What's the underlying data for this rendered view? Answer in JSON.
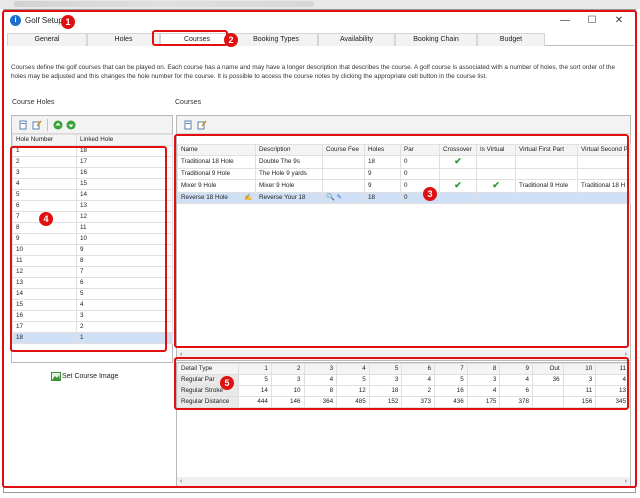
{
  "window": {
    "title": "Golf Setup",
    "app_icon": "golf-app-icon"
  },
  "window_controls": {
    "minimize": "—",
    "maximize": "☐",
    "close": "✕"
  },
  "tabs": [
    {
      "label": "General"
    },
    {
      "label": "Holes"
    },
    {
      "label": "Courses"
    },
    {
      "label": "Booking Types"
    },
    {
      "label": "Availability"
    },
    {
      "label": "Booking Chain"
    },
    {
      "label": "Budget"
    }
  ],
  "active_tab": "Courses",
  "description": "Courses define the golf courses that can be played on. Each course has a name and may have a longer description that describes the course. A golf course is associated with a number of holes, the sort order of the holes may be adjusted and this changes the hole number for the course. It is possible to access the course notes by clicking the appropriate cell button in the course list.",
  "course_holes": {
    "label": "Course Holes",
    "columns": [
      "Hole Number",
      "Linked Hole"
    ],
    "rows": [
      [
        "1",
        "18"
      ],
      [
        "2",
        "17"
      ],
      [
        "3",
        "16"
      ],
      [
        "4",
        "15"
      ],
      [
        "5",
        "14"
      ],
      [
        "6",
        "13"
      ],
      [
        "7",
        "12"
      ],
      [
        "8",
        "11"
      ],
      [
        "9",
        "10"
      ],
      [
        "10",
        "9"
      ],
      [
        "11",
        "8"
      ],
      [
        "12",
        "7"
      ],
      [
        "13",
        "6"
      ],
      [
        "14",
        "5"
      ],
      [
        "15",
        "4"
      ],
      [
        "16",
        "3"
      ],
      [
        "17",
        "2"
      ],
      [
        "18",
        "1"
      ]
    ],
    "selected_row": 17,
    "set_image_label": "Set Course Image"
  },
  "courses": {
    "label": "Courses",
    "columns": [
      "Name",
      "Description",
      "Course Fee",
      "Holes",
      "Par",
      "Crossover",
      "Is Virtual",
      "Virtual First Part",
      "Virtual Second P"
    ],
    "rows": [
      {
        "name": "Traditional 18 Hole",
        "description": "Double The 9s",
        "fee": "",
        "holes": "18",
        "par": "0",
        "crossover": true,
        "virtual": false,
        "first": "",
        "second": ""
      },
      {
        "name": "Traditional 9 Hole",
        "description": "The Hole 9 yards",
        "fee": "",
        "holes": "9",
        "par": "0",
        "crossover": false,
        "virtual": false,
        "first": "",
        "second": ""
      },
      {
        "name": "Mixer 9 Hole",
        "description": "Mixer 9 Hole",
        "fee": "",
        "holes": "9",
        "par": "0",
        "crossover": true,
        "virtual": true,
        "first": "Traditional 9 Hole",
        "second": "Traditional 18 H"
      },
      {
        "name": "Reverse 18 Hole",
        "description": "Reverse Your 18",
        "fee": "",
        "holes": "18",
        "par": "0",
        "crossover": false,
        "virtual": false,
        "first": "",
        "second": ""
      }
    ],
    "selected_row": 3
  },
  "details": {
    "columns": [
      "Detail Type",
      "1",
      "2",
      "3",
      "4",
      "5",
      "6",
      "7",
      "8",
      "9",
      "Out",
      "10",
      "11"
    ],
    "rows": [
      [
        "Regular Par",
        "5",
        "3",
        "4",
        "5",
        "3",
        "4",
        "5",
        "3",
        "4",
        "36",
        "3",
        "4"
      ],
      [
        "Regular Stroke",
        "14",
        "10",
        "8",
        "12",
        "18",
        "2",
        "16",
        "4",
        "6",
        "",
        "11",
        "13"
      ],
      [
        "Regular Distance",
        "444",
        "146",
        "364",
        "485",
        "152",
        "373",
        "436",
        "175",
        "378",
        "",
        "156",
        "345"
      ]
    ]
  },
  "callouts": [
    "1",
    "2",
    "3",
    "4",
    "5"
  ],
  "colors": {
    "callout": "#e01010",
    "selection": "#cfe0f6",
    "check": "#2e9a36",
    "app_icon": "#1e6fd0"
  }
}
